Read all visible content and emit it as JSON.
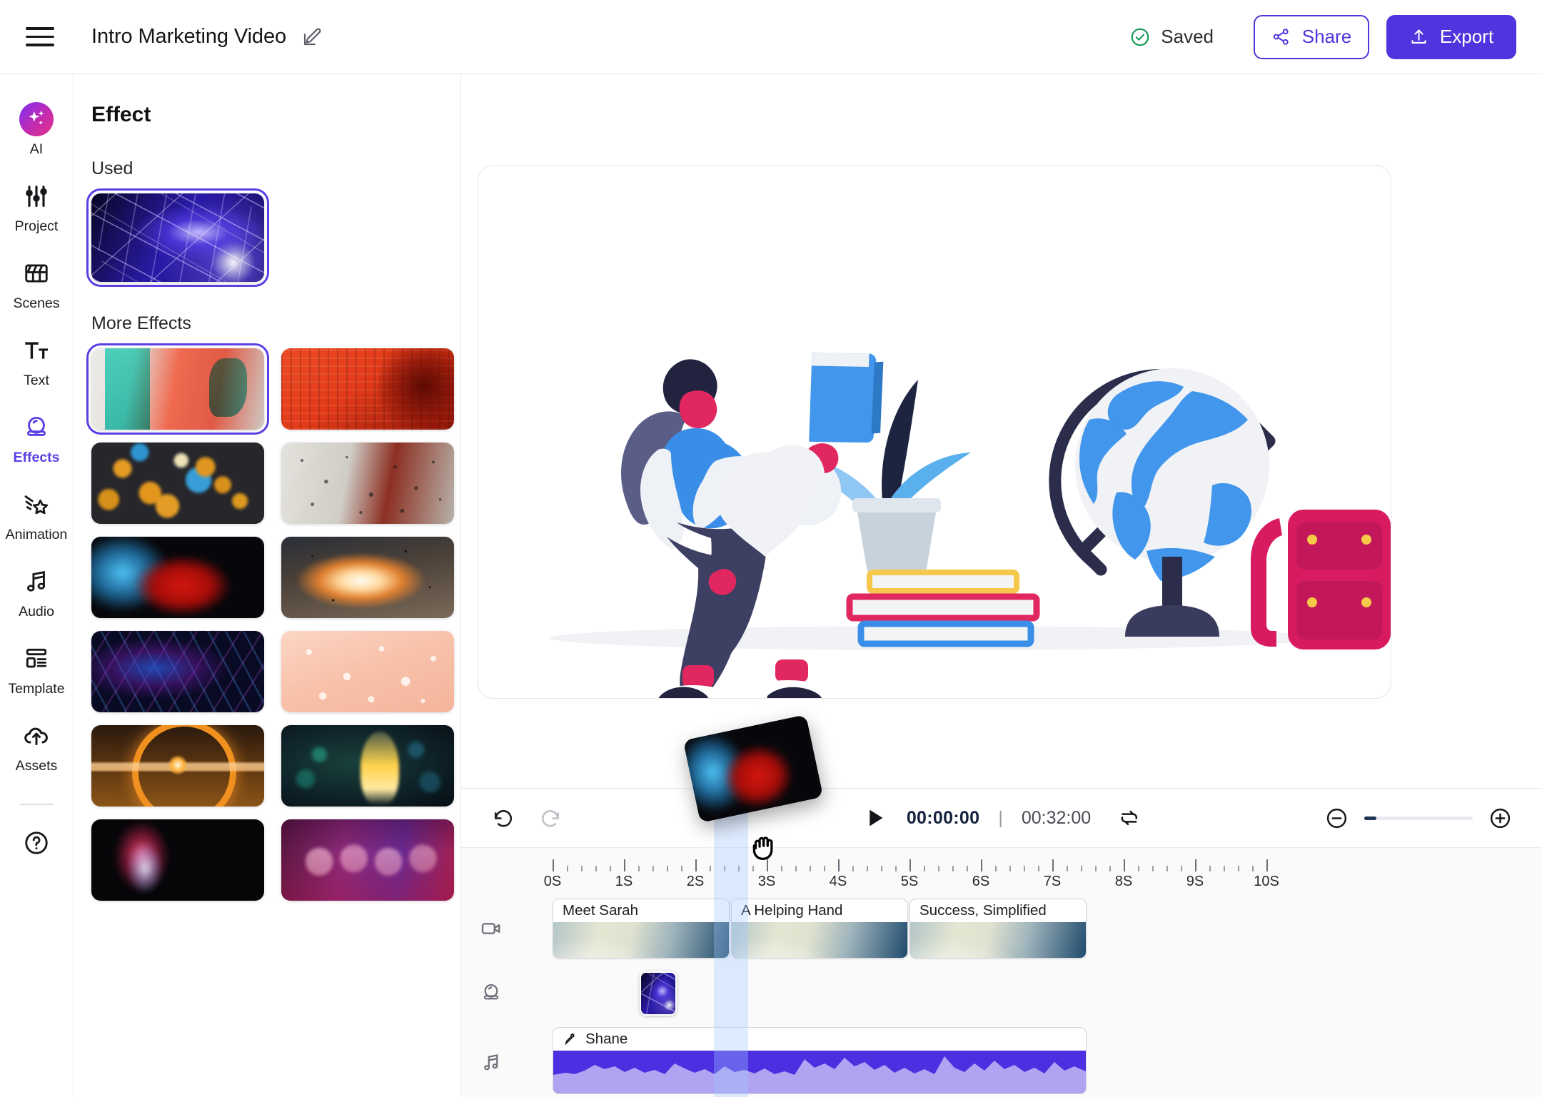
{
  "topbar": {
    "menu_icon": "hamburger-menu-icon",
    "project_title": "Intro Marketing Video",
    "edit_icon": "edit-pencil-icon",
    "save_status": "Saved",
    "save_status_icon": "check-circle-icon",
    "save_status_color": "#1a9e5c",
    "share_label": "Share",
    "share_icon": "share-nodes-icon",
    "export_label": "Export",
    "export_icon": "upload-arrow-icon",
    "accent_color": "#4f35dd"
  },
  "rail": {
    "items": [
      {
        "label": "AI",
        "icon": "sparkles-icon",
        "active": false
      },
      {
        "label": "Project",
        "icon": "sliders-icon",
        "active": false
      },
      {
        "label": "Scenes",
        "icon": "clapperboard-icon",
        "active": false
      },
      {
        "label": "Text",
        "icon": "text-size-icon",
        "active": false
      },
      {
        "label": "Effects",
        "icon": "crystal-ball-icon",
        "active": true
      },
      {
        "label": "Animation",
        "icon": "shooting-star-icon",
        "active": false
      },
      {
        "label": "Audio",
        "icon": "music-note-icon",
        "active": false
      },
      {
        "label": "Template",
        "icon": "layout-template-icon",
        "active": false
      },
      {
        "label": "Assets",
        "icon": "cloud-upload-icon",
        "active": false
      }
    ],
    "help_icon": "question-circle-icon"
  },
  "panel": {
    "title": "Effect",
    "used_heading": "Used",
    "used": [
      {
        "name": "laser-beams-effect",
        "art": "laser",
        "selected": true
      }
    ],
    "more_heading": "More Effects",
    "more": [
      {
        "name": "chromatic-glitch-portrait-effect",
        "art": "glitchface",
        "selected": true
      },
      {
        "name": "red-code-overlay-effect",
        "art": "redmatrix",
        "selected": false
      },
      {
        "name": "golden-bokeh-effect",
        "art": "bokeh",
        "selected": false
      },
      {
        "name": "rain-on-glass-effect",
        "art": "raindrop",
        "selected": false
      },
      {
        "name": "red-blue-ink-smoke-effect",
        "art": "inksmoke",
        "selected": false
      },
      {
        "name": "explosion-blast-effect",
        "art": "explosion",
        "selected": false
      },
      {
        "name": "neon-warp-tunnel-effect",
        "art": "neonwarp",
        "selected": false
      },
      {
        "name": "water-droplets-effect",
        "art": "waterdrops",
        "selected": false
      },
      {
        "name": "sunset-ring-glow-effect",
        "art": "sunring",
        "selected": false
      },
      {
        "name": "sparkler-fireworks-effect",
        "art": "sparkler",
        "selected": false
      },
      {
        "name": "pink-smoke-wisp-effect",
        "art": "pinksmoke",
        "selected": false
      },
      {
        "name": "echo-faces-kaleidoscope-effect",
        "art": "echofaces",
        "selected": false
      }
    ]
  },
  "preview": {
    "illustration": "student-walking-with-book-globe-backpack-books-plant"
  },
  "timeline": {
    "undo_icon": "undo-arrow-icon",
    "redo_icon": "redo-arrow-icon",
    "play_icon": "play-triangle-icon",
    "current_time": "00:00:00",
    "time_separator": "|",
    "total_time": "00:32:00",
    "loop_icon": "loop-repeat-icon",
    "zoom_out_icon": "zoom-out-circle-icon",
    "zoom_in_icon": "zoom-in-circle-icon",
    "zoom_level_percent": 11,
    "ruler": {
      "labels": [
        "0S",
        "1S",
        "2S",
        "3S",
        "4S",
        "5S",
        "6S",
        "7S",
        "8S",
        "9S",
        "10S"
      ],
      "major_spacing_px": 100,
      "minor_per_major": 5
    },
    "playhead_seconds": 2.5,
    "tracks": [
      {
        "kind": "video",
        "icon": "video-camera-icon",
        "clips": [
          {
            "label": "Meet Sarah",
            "start_s": 0.08,
            "end_s": 2.5
          },
          {
            "label": "A Helping Hand",
            "start_s": 2.58,
            "end_s": 5.0
          },
          {
            "label": "Success, Simplified",
            "start_s": 5.08,
            "end_s": 7.5
          }
        ]
      },
      {
        "kind": "effect",
        "icon": "crystal-ball-icon",
        "clips": [
          {
            "label": "",
            "art": "laser",
            "start_s": 1.2,
            "end_s": 1.53
          }
        ]
      },
      {
        "kind": "audio",
        "icon": "music-note-icon",
        "clips": [
          {
            "label": "Shane",
            "icon": "microphone-icon",
            "start_s": 0.08,
            "end_s": 7.5
          }
        ]
      }
    ],
    "drag": {
      "name": "red-blue-ink-smoke-effect",
      "art": "inksmoke",
      "cursor": "grabbing-hand-cursor"
    }
  }
}
